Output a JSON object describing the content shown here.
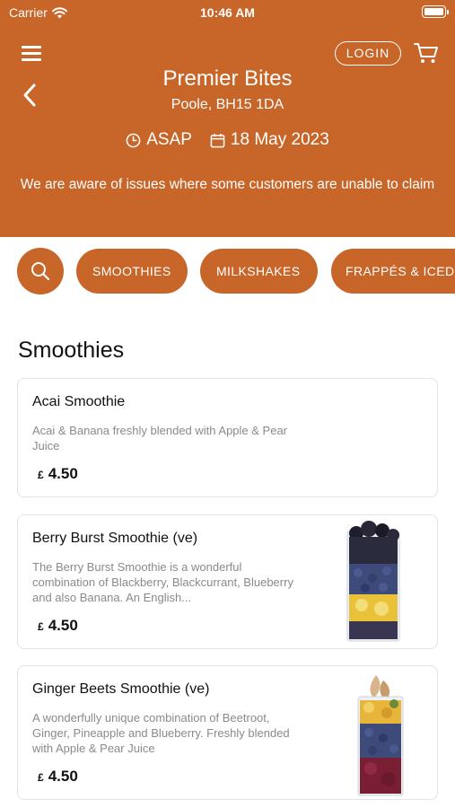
{
  "status_bar": {
    "carrier": "Carrier",
    "time": "10:46 AM"
  },
  "header": {
    "login_label": "LOGIN",
    "store_name": "Premier Bites",
    "location": "Poole, BH15 1DA",
    "time_option": "ASAP",
    "date": "18 May 2023",
    "notice": "We are aware of issues where some customers are unable to claim"
  },
  "categories": [
    "SMOOTHIES",
    "MILKSHAKES",
    "FRAPPÉS & ICED"
  ],
  "section": {
    "title": "Smoothies"
  },
  "items": [
    {
      "name": "Acai Smoothie",
      "description": "Acai & Banana freshly blended with Apple & Pear Juice",
      "currency": "£",
      "price": "4.50"
    },
    {
      "name": "Berry Burst Smoothie (ve)",
      "description": "The Berry Burst Smoothie is a wonderful combination of Blackberry, Blackcurrant, Blueberry and also Banana. An English...",
      "currency": "£",
      "price": "4.50"
    },
    {
      "name": "Ginger Beets Smoothie (ve)",
      "description": "A wonderfully unique combination of Beetroot, Ginger, Pineapple and Blueberry. Freshly blended with Apple & Pear Juice",
      "currency": "£",
      "price": "4.50"
    }
  ],
  "colors": {
    "brand": "#c8662a",
    "muted_text": "#8a8a8a",
    "card_border": "#e3e3e3"
  },
  "icons": [
    "wifi-icon",
    "battery-icon",
    "menu-icon",
    "back-chevron-icon",
    "cart-icon",
    "clock-icon",
    "calendar-icon",
    "search-icon"
  ]
}
